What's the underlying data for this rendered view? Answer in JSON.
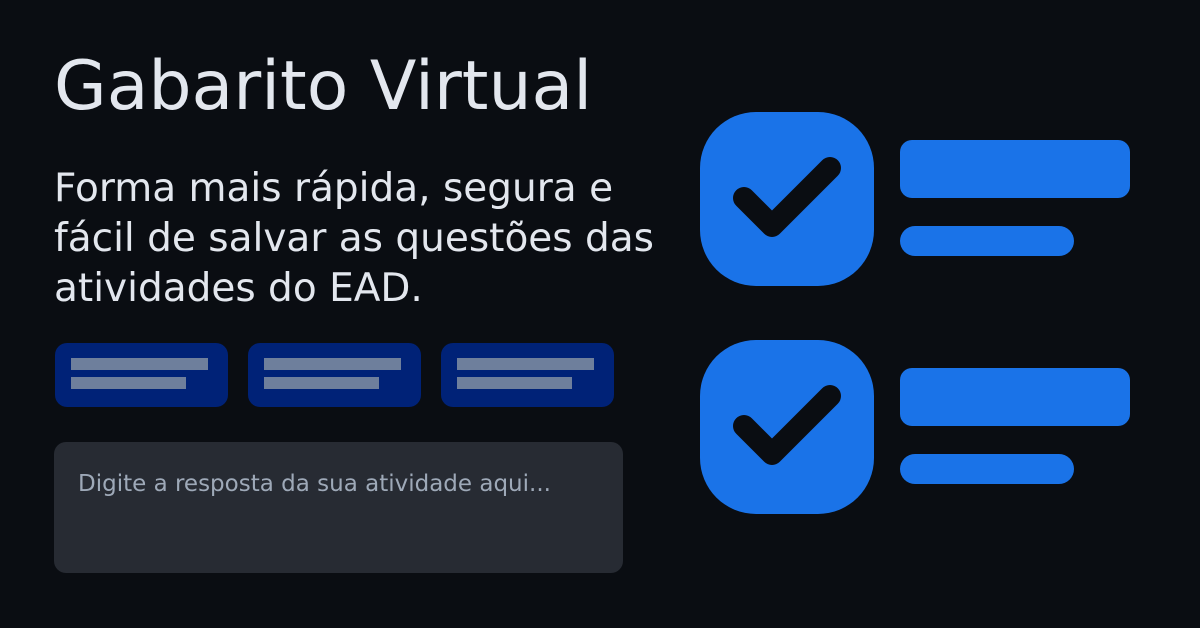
{
  "header": {
    "title": "Gabarito Virtual",
    "subtitle": "Forma mais rápida, segura e fácil de salvar as questões das atividades do EAD."
  },
  "answer_box": {
    "placeholder": "Digite a resposta da sua atividade aqui...",
    "value": ""
  },
  "colors": {
    "background": "#0a0d12",
    "accent": "#1a73e8",
    "card": "#002277",
    "input": "#272b33",
    "text": "#e3e7ee"
  },
  "icons": [
    "checkmark-icon",
    "checkmark-icon"
  ]
}
